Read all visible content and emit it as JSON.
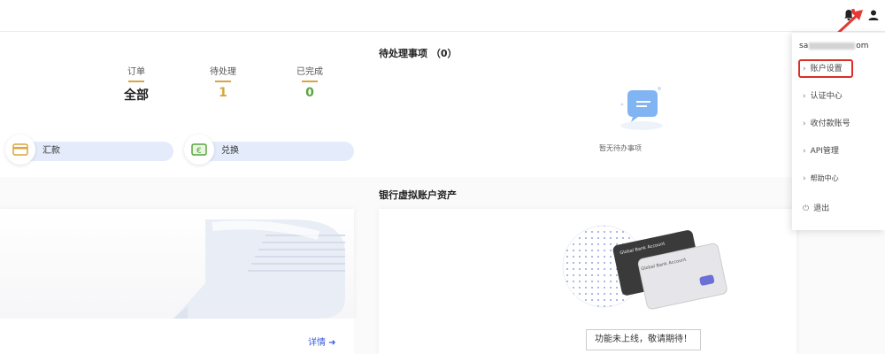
{
  "header": {
    "bell_icon": "bell-icon",
    "user_icon": "user-icon",
    "accent": "#e53935"
  },
  "orders": {
    "stats": [
      {
        "label": "订单",
        "value": "全部",
        "color": "#222222"
      },
      {
        "label": "待处理",
        "value": "1",
        "color": "#d4a73c"
      },
      {
        "label": "已完成",
        "value": "0",
        "color": "#5aa63e"
      }
    ]
  },
  "actions": {
    "remit": "汇款",
    "exchange": "兑换"
  },
  "banner": {
    "details": "详情 ➜"
  },
  "pending": {
    "title": "待处理事项 （0）",
    "empty": "暂无待办事项"
  },
  "assets": {
    "title": "银行虚拟账户资产",
    "card_text": "Global Bank Account",
    "notice": "功能未上线，敬请期待！"
  },
  "account_menu": {
    "email_prefix": "sa",
    "email_suffix": "om",
    "items": [
      {
        "label": "账户设置",
        "icon": "chevron-right-icon"
      },
      {
        "label": "认证中心",
        "icon": "chevron-right-icon"
      },
      {
        "label": "收付款账号",
        "icon": "chevron-right-icon"
      },
      {
        "label": "API管理",
        "icon": "chevron-right-icon"
      },
      {
        "label": "帮助中心",
        "icon": "chevron-right-icon"
      },
      {
        "label": "退出",
        "icon": "power-icon"
      }
    ]
  }
}
